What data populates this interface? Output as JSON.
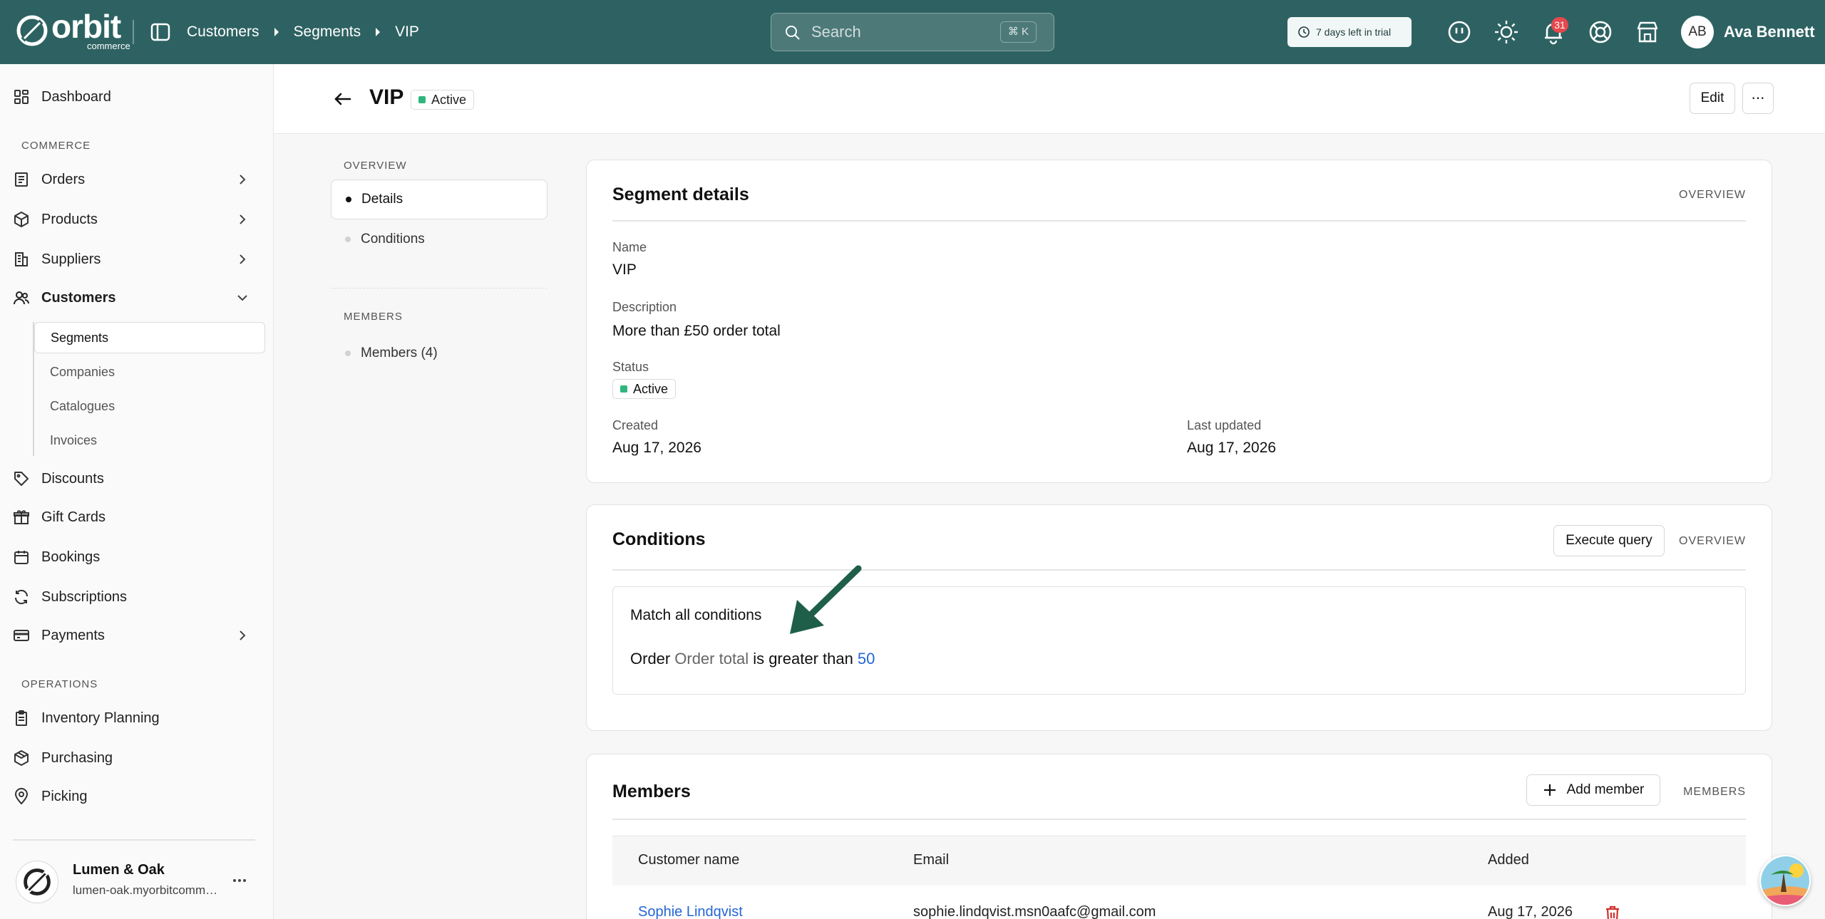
{
  "app": {
    "logo_word": "orbit",
    "logo_sub": "commerce"
  },
  "breadcrumbs": [
    "Customers",
    "Segments",
    "VIP"
  ],
  "search": {
    "placeholder": "Search",
    "shortcut": "⌘ K"
  },
  "trial": {
    "label": "7 days left in trial"
  },
  "topbar_icons": [
    "feedback-icon",
    "theme-sun-icon",
    "bell-icon",
    "help-lifebuoy-icon",
    "store-icon"
  ],
  "notifications": {
    "count": "31"
  },
  "user": {
    "initials": "AB",
    "name": "Ava Bennett"
  },
  "sidebar": {
    "dashboard": "Dashboard",
    "commerce_heading": "COMMERCE",
    "commerce_items": [
      {
        "label": "Orders",
        "icon": "orders-icon"
      },
      {
        "label": "Products",
        "icon": "products-box-icon"
      },
      {
        "label": "Suppliers",
        "icon": "suppliers-building-icon"
      },
      {
        "label": "Customers",
        "icon": "customers-users-icon"
      }
    ],
    "customers_sub": [
      "Segments",
      "Companies",
      "Catalogues",
      "Invoices"
    ],
    "more_items": [
      {
        "label": "Discounts",
        "icon": "tag-icon"
      },
      {
        "label": "Gift Cards",
        "icon": "gift-icon"
      },
      {
        "label": "Bookings",
        "icon": "calendar-icon"
      },
      {
        "label": "Subscriptions",
        "icon": "refresh-icon"
      },
      {
        "label": "Payments",
        "icon": "card-icon"
      }
    ],
    "operations_heading": "OPERATIONS",
    "operations_items": [
      {
        "label": "Inventory Planning",
        "icon": "clipboard-icon"
      },
      {
        "label": "Purchasing",
        "icon": "purchasing-icon"
      },
      {
        "label": "Picking",
        "icon": "location-pin-icon"
      }
    ],
    "store": {
      "name": "Lumen & Oak",
      "url": "lumen-oak.myorbitcommerce.com"
    }
  },
  "page": {
    "title": "VIP",
    "status": "Active",
    "edit_label": "Edit",
    "more_label": "⋯"
  },
  "section_nav": {
    "overview_heading": "OVERVIEW",
    "overview_items": [
      "Details",
      "Conditions"
    ],
    "members_heading": "MEMBERS",
    "members_items": [
      "Members (4)"
    ]
  },
  "details_card": {
    "title": "Segment details",
    "tag": "OVERVIEW",
    "name_label": "Name",
    "name_value": "VIP",
    "description_label": "Description",
    "description_value": "More than £50 order total",
    "status_label": "Status",
    "status_value": "Active",
    "created_label": "Created",
    "created_value": "Aug 17, 2026",
    "updated_label": "Last updated",
    "updated_value": "Aug 17, 2026"
  },
  "conditions_card": {
    "title": "Conditions",
    "execute_label": "Execute query",
    "tag": "OVERVIEW",
    "match_text": "Match all conditions",
    "condition": {
      "entity": "Order",
      "field": "Order total",
      "operator": "is greater than",
      "value": "50"
    }
  },
  "members_card": {
    "title": "Members",
    "add_label": "Add member",
    "tag": "MEMBERS",
    "columns": [
      "Customer name",
      "Email",
      "Added"
    ],
    "rows": [
      {
        "name": "Sophie Lindqvist",
        "email": "sophie.lindqvist.msn0aafc@gmail.com",
        "added": "Aug 17, 2026"
      }
    ]
  },
  "colors": {
    "topbar": "#2e6262",
    "accent_link": "#2566d6",
    "status_green": "#2fb67c",
    "badge_red": "#e5484d",
    "annotation_arrow": "#1f5f4a",
    "delete_red": "#d0312d"
  }
}
